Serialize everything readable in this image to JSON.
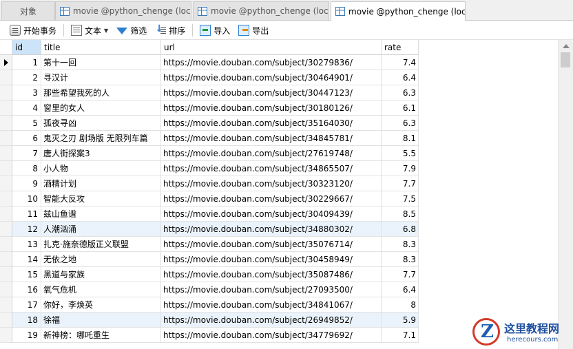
{
  "tabs": [
    {
      "label": "对象"
    },
    {
      "label": "movie @python_chenge (loc..."
    },
    {
      "label": "movie @python_chenge (loc..."
    },
    {
      "label": "movie @python_chenge (loc..."
    }
  ],
  "toolbar": {
    "begin_transaction": "开始事务",
    "text": "文本",
    "filter": "筛选",
    "sort": "排序",
    "import": "导入",
    "export": "导出"
  },
  "grid": {
    "columns": [
      "id",
      "title",
      "url",
      "rate"
    ],
    "rows": [
      {
        "id": "1",
        "title": "第十一回",
        "url": "https://movie.douban.com/subject/30279836/",
        "rate": "7.4"
      },
      {
        "id": "2",
        "title": "寻汉计",
        "url": "https://movie.douban.com/subject/30464901/",
        "rate": "6.4"
      },
      {
        "id": "3",
        "title": "那些希望我死的人",
        "url": "https://movie.douban.com/subject/30447123/",
        "rate": "6.3"
      },
      {
        "id": "4",
        "title": "窗里的女人",
        "url": "https://movie.douban.com/subject/30180126/",
        "rate": "6.1"
      },
      {
        "id": "5",
        "title": "孤夜寻凶",
        "url": "https://movie.douban.com/subject/35164030/",
        "rate": "6.3"
      },
      {
        "id": "6",
        "title": "鬼灭之刃 剧场版 无限列车篇",
        "url": "https://movie.douban.com/subject/34845781/",
        "rate": "8.1"
      },
      {
        "id": "7",
        "title": "唐人街探案3",
        "url": "https://movie.douban.com/subject/27619748/",
        "rate": "5.5"
      },
      {
        "id": "8",
        "title": "小人物",
        "url": "https://movie.douban.com/subject/34865507/",
        "rate": "7.9"
      },
      {
        "id": "9",
        "title": "酒精计划",
        "url": "https://movie.douban.com/subject/30323120/",
        "rate": "7.7"
      },
      {
        "id": "10",
        "title": "智能大反攻",
        "url": "https://movie.douban.com/subject/30229667/",
        "rate": "7.5"
      },
      {
        "id": "11",
        "title": "兹山鱼谱",
        "url": "https://movie.douban.com/subject/30409439/",
        "rate": "8.5"
      },
      {
        "id": "12",
        "title": "人潮汹涌",
        "url": "https://movie.douban.com/subject/34880302/",
        "rate": "6.8"
      },
      {
        "id": "13",
        "title": "扎克·施奈德版正义联盟",
        "url": "https://movie.douban.com/subject/35076714/",
        "rate": "8.3"
      },
      {
        "id": "14",
        "title": "无依之地",
        "url": "https://movie.douban.com/subject/30458949/",
        "rate": "8.3"
      },
      {
        "id": "15",
        "title": "黑道与家族",
        "url": "https://movie.douban.com/subject/35087486/",
        "rate": "7.7"
      },
      {
        "id": "16",
        "title": "氧气危机",
        "url": "https://movie.douban.com/subject/27093500/",
        "rate": "6.4"
      },
      {
        "id": "17",
        "title": "你好，李焕英",
        "url": "https://movie.douban.com/subject/34841067/",
        "rate": "8"
      },
      {
        "id": "18",
        "title": "徐福",
        "url": "https://movie.douban.com/subject/26949852/",
        "rate": "5.9"
      },
      {
        "id": "19",
        "title": "新神榜：哪吒重生",
        "url": "https://movie.douban.com/subject/34779692/",
        "rate": "7.1"
      }
    ]
  },
  "watermark": {
    "cn": "这里教程网",
    "en": "herecours.com"
  },
  "colors": {
    "accent": "#2f7fd0",
    "row_alt": "#eaf3fb",
    "header_selected": "#cde3f7"
  }
}
